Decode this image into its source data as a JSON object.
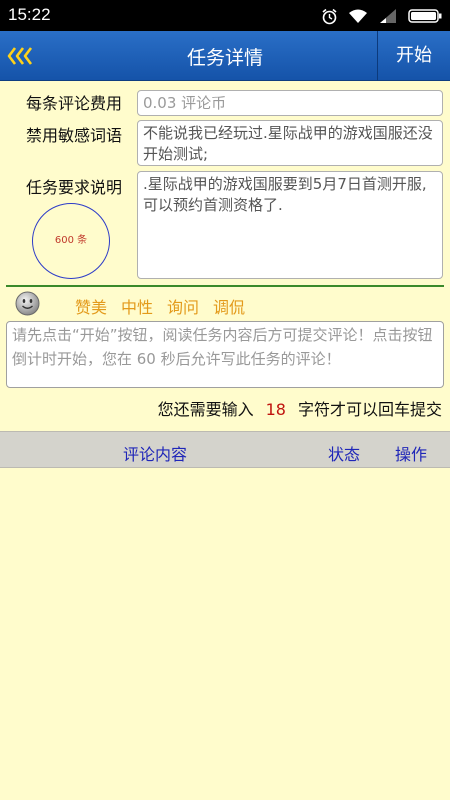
{
  "status_bar": {
    "time": "15:22",
    "icons": [
      "alarm-icon",
      "wifi-icon",
      "signal-icon",
      "battery-icon"
    ]
  },
  "header": {
    "back_icon": "triple-chevron-left-icon",
    "title": "任务详情",
    "start_label": "开始"
  },
  "form": {
    "fee_label": "每条评论费用",
    "fee_value": "0.03 评论币",
    "banned_label": "禁用敏感词语",
    "banned_value": "不能说我已经玩过.星际战甲的游戏国服还没开始测试;",
    "req_label": "任务要求说明",
    "req_value": ".星际战甲的游戏国服要到5月7日首测开服,可以预约首测资格了.",
    "quota": "600 条"
  },
  "tones": {
    "icon": "smiley-icon",
    "options": [
      "赞美",
      "中性",
      "询问",
      "调侃"
    ]
  },
  "comment": {
    "placeholder": "请先点击“开始”按钮，阅读任务内容后方可提交评论！点击按钮倒计时开始，您在 60 秒后允许写此任务的评论！"
  },
  "hint": {
    "prefix": "您还需要输入",
    "count": "18",
    "suffix": "字符才可以回车提交"
  },
  "table": {
    "headers": [
      "评论内容",
      "状态",
      "操作"
    ]
  },
  "colors": {
    "background": "#fffccc",
    "header_blue": "#1c5fb6",
    "tone_orange": "#e39a1b",
    "column_blue": "#1f26b8",
    "count_red": "#c0140f"
  }
}
